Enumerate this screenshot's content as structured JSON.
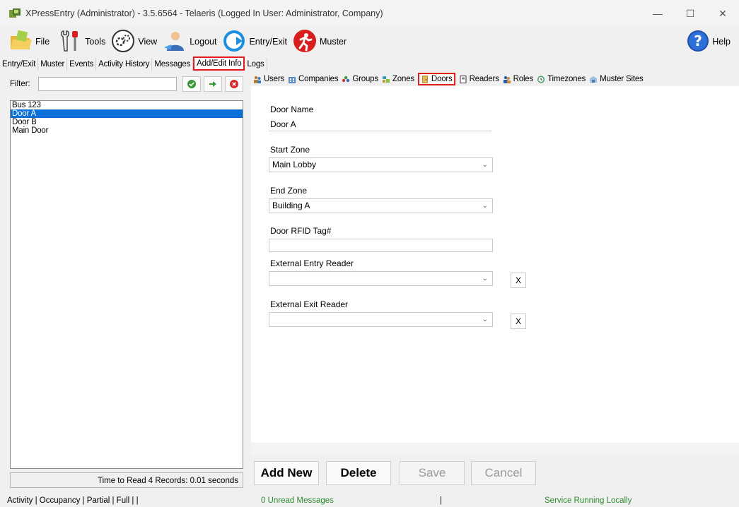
{
  "window": {
    "title": "XPressEntry (Administrator)  - 3.5.6564 - Telaeris (Logged In User: Administrator, Company)",
    "controls": [
      "—",
      "☐",
      "✕"
    ]
  },
  "toolbar": {
    "file": "File",
    "tools": "Tools",
    "view": "View",
    "logout": "Logout",
    "entry_exit": "Entry/Exit",
    "muster": "Muster",
    "help": "Help"
  },
  "main_tabs": [
    {
      "label": "Entry/Exit",
      "active": false
    },
    {
      "label": "Muster",
      "active": false
    },
    {
      "label": "Events",
      "active": false
    },
    {
      "label": "Activity History",
      "active": false
    },
    {
      "label": "Messages",
      "active": false
    },
    {
      "label": "Add/Edit Info",
      "active": true
    },
    {
      "label": "Logs",
      "active": false
    }
  ],
  "left": {
    "filter_label": "Filter:",
    "filter_value": "",
    "items": [
      {
        "label": "Bus 123",
        "selected": false
      },
      {
        "label": "Door A",
        "selected": true
      },
      {
        "label": "Door B",
        "selected": false
      },
      {
        "label": "Main Door",
        "selected": false
      }
    ],
    "status": "Time to Read 4 Records: 0.01 seconds"
  },
  "sub_tabs": [
    {
      "label": "Users",
      "icon": "users-icon",
      "active": false
    },
    {
      "label": "Companies",
      "icon": "companies-icon",
      "active": false
    },
    {
      "label": "Groups",
      "icon": "groups-icon",
      "active": false
    },
    {
      "label": "Zones",
      "icon": "zones-icon",
      "active": false
    },
    {
      "label": "Doors",
      "icon": "door-icon",
      "active": true
    },
    {
      "label": "Readers",
      "icon": "reader-icon",
      "active": false
    },
    {
      "label": "Roles",
      "icon": "roles-icon",
      "active": false
    },
    {
      "label": "Timezones",
      "icon": "timezone-icon",
      "active": false
    },
    {
      "label": "Muster Sites",
      "icon": "muster-site-icon",
      "active": false
    }
  ],
  "form": {
    "door_name_label": "Door Name",
    "door_name_value": "Door A",
    "start_zone_label": "Start Zone",
    "start_zone_value": "Main Lobby",
    "end_zone_label": "End Zone",
    "end_zone_value": "Building A",
    "rfid_label": "Door RFID Tag#",
    "rfid_value": "",
    "entry_reader_label": "External Entry Reader",
    "entry_reader_value": "",
    "exit_reader_label": "External Exit Reader",
    "exit_reader_value": "",
    "clear_label": "X"
  },
  "actions": {
    "add_new": "Add New",
    "delete": "Delete",
    "save": "Save",
    "cancel": "Cancel"
  },
  "statusbar": {
    "left": "Activity | Occupancy | Partial | Full |  |",
    "messages": "0 Unread Messages",
    "sep": "|",
    "service": "Service Running Locally"
  },
  "colors": {
    "highlight_border": "#e21b1b",
    "selection": "#0a6fd6",
    "status_green": "#2e8b2e"
  }
}
